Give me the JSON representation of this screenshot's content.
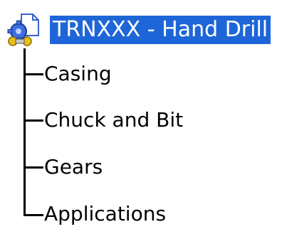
{
  "tree": {
    "root": {
      "label": "TRNXXX - Hand Drill",
      "icon": "assembly-product-icon",
      "selected": true,
      "highlight_color": "#1e66d8"
    },
    "children": [
      {
        "label": "Casing"
      },
      {
        "label": "Chuck and Bit"
      },
      {
        "label": "Gears"
      },
      {
        "label": "Applications"
      }
    ]
  }
}
